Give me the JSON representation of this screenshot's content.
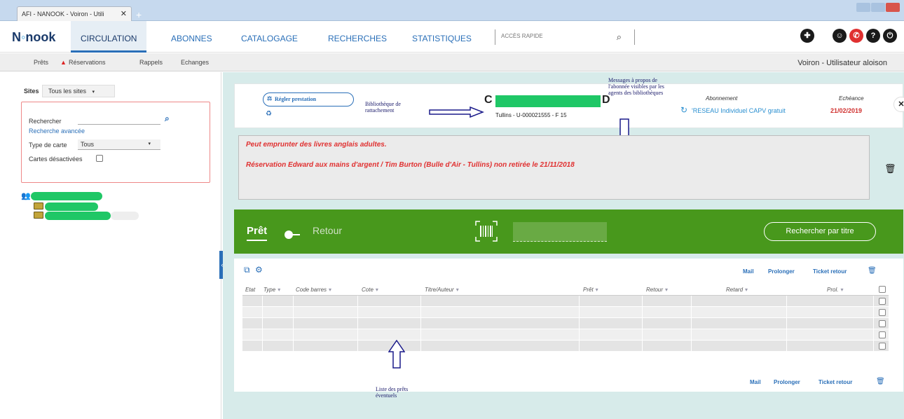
{
  "browser": {
    "tab_title": "AFI - NANOOK - Voiron - Utili",
    "new_tab": "+"
  },
  "nav": {
    "logo": "Nanook",
    "items": [
      "CIRCULATION",
      "ABONNES",
      "CATALOGAGE",
      "RECHERCHES",
      "STATISTIQUES"
    ],
    "active": "CIRCULATION",
    "quick_access_placeholder": "ACCÈS RAPIDE"
  },
  "subnav": {
    "items": [
      "Prêts",
      "Réservations",
      "Rappels",
      "Echanges"
    ],
    "user": "Voiron - Utilisateur aloison"
  },
  "left": {
    "sites_label": "Sites",
    "sites_value": "Tous les sites",
    "search_label": "Rechercher",
    "advanced_link": "Recherche avancée",
    "card_type_label": "Type de carte",
    "card_type_value": "Tous",
    "disabled_cards_label": "Cartes désactivées"
  },
  "header": {
    "settle_button": "Régler prestation",
    "name_first": "C",
    "name_last": "D",
    "id_line": "Tullins - U-000021555 - F 15",
    "subscription_label": "Abonnement",
    "subscription_value": "'RESEAU Individuel CAPV gratuit",
    "due_label": "Echéance",
    "due_value": "21/02/2019"
  },
  "annotations": {
    "library": "Bibliothèque de rattachement",
    "messages": "Messages à propos de l'abonnée visibles par les agents des bibliothèques",
    "loans": "Liste des prêts éventuels"
  },
  "messages": [
    "Peut emprunter des livres anglais adultes.",
    "Réservation Edward aux mains d'argent / Tim Burton (Bulle d'Air - Tullins) non retirée le 21/11/2018"
  ],
  "loan_bar": {
    "pret": "Prêt",
    "retour": "Retour",
    "search_by_title": "Rechercher par titre"
  },
  "loans": {
    "actions": [
      "Mail",
      "Prolonger",
      "Ticket retour"
    ],
    "columns": [
      "Etat",
      "Type",
      "Code barres",
      "Cote",
      "Titre/Auteur",
      "Prêt",
      "Retour",
      "Retard",
      "Prol."
    ],
    "row_count": 5
  },
  "colors": {
    "primary": "#2a6fb8",
    "green_bar": "#48981c",
    "alert": "#e03030",
    "mask": "#1fc766",
    "panel_bg": "#d7ebea"
  }
}
